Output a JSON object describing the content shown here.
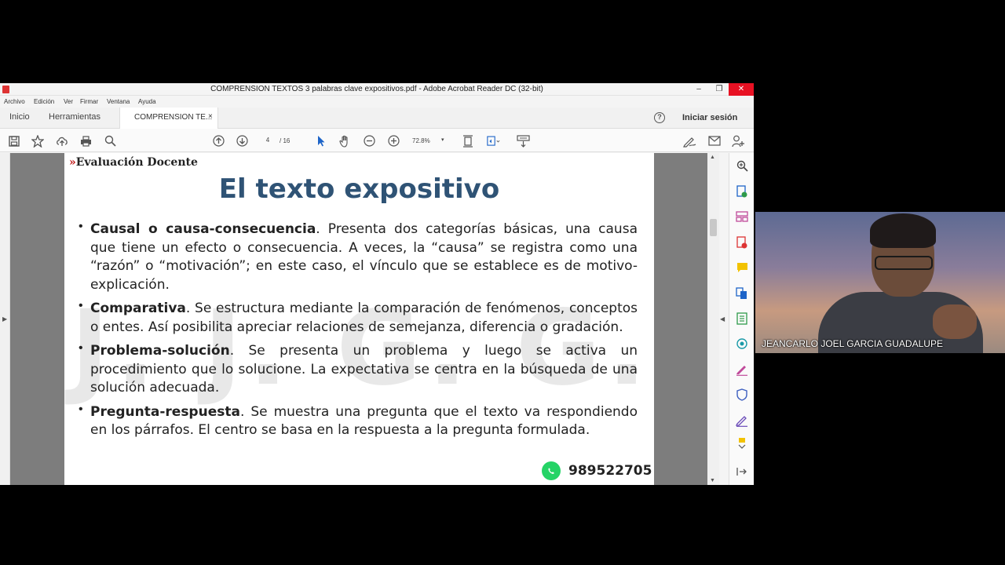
{
  "window": {
    "title": "COMPRENSION TEXTOS 3 palabras clave expositivos.pdf - Adobe Acrobat Reader DC (32-bit)",
    "minimize": "–",
    "restore": "❐",
    "close": "✕"
  },
  "menu": [
    "Archivo",
    "Edición",
    "Ver",
    "Firmar",
    "Ventana",
    "Ayuda"
  ],
  "tabs": {
    "home": "Inicio",
    "tools": "Herramientas",
    "document": "COMPRENSION TE...",
    "document_close": "×",
    "help": "?",
    "signin": "Iniciar sesión"
  },
  "toolbar": {
    "page_current": "4",
    "page_total": "/ 16",
    "zoom": "72.8%",
    "zoom_caret": "▾",
    "icons": [
      "save-icon",
      "star-icon",
      "cloud-upload-icon",
      "print-icon",
      "search-icon",
      "page-up-icon",
      "page-down-icon",
      "pointer-icon",
      "hand-icon",
      "zoom-out-icon",
      "zoom-in-icon",
      "fit-page-icon",
      "page-display-icon",
      "scroll-mode-icon",
      "sign-icon",
      "email-icon",
      "share-user-icon"
    ]
  },
  "pdf": {
    "brand_chevron": "»",
    "brand": "Evaluación Docente",
    "title": "El  texto expositivo",
    "watermark": "J. J. G. G.",
    "bullets": [
      {
        "term": "Causal o causa-consecuencia",
        "text": ". Presenta dos categorías básicas, una causa que tiene un efecto o consecuencia. A veces, la “causa” se registra como una “razón” o “motivación”; en este caso, el vínculo que se establece es de motivo-explicación."
      },
      {
        "term": "Comparativa",
        "text": ". Se estructura mediante la comparación de fenómenos, conceptos o entes. Así posibilita apreciar relaciones de semejanza, diferencia o gradación."
      },
      {
        "term": "Problema-solución",
        "text": ". Se presenta un problema y luego se activa un procedimiento que lo solucione. La expectativa se centra en la búsqueda de una solución adecuada."
      },
      {
        "term": "Pregunta-respuesta",
        "text": ". Se muestra una pregunta que el texto va respondiendo en los párrafos. El centro se basa en la respuesta a la pregunta formulada."
      }
    ],
    "phone": "989522705"
  },
  "right_panel_icons": [
    "zoom-icon",
    "export-pdf-icon",
    "organize-pages-icon",
    "create-pdf-icon",
    "comment-icon",
    "combine-files-icon",
    "compress-icon",
    "enhance-scan-icon",
    "fill-sign-icon",
    "protect-icon",
    "edit-pdf-icon",
    "more-tools-icon"
  ],
  "video": {
    "participant_name": "JEANCARLO JOEL GARCIA GUADALUPE"
  },
  "colors": {
    "title_blue": "#2f5375",
    "brand_red": "#c01818",
    "whatsapp_green": "#25d366",
    "close_red": "#e81123"
  }
}
